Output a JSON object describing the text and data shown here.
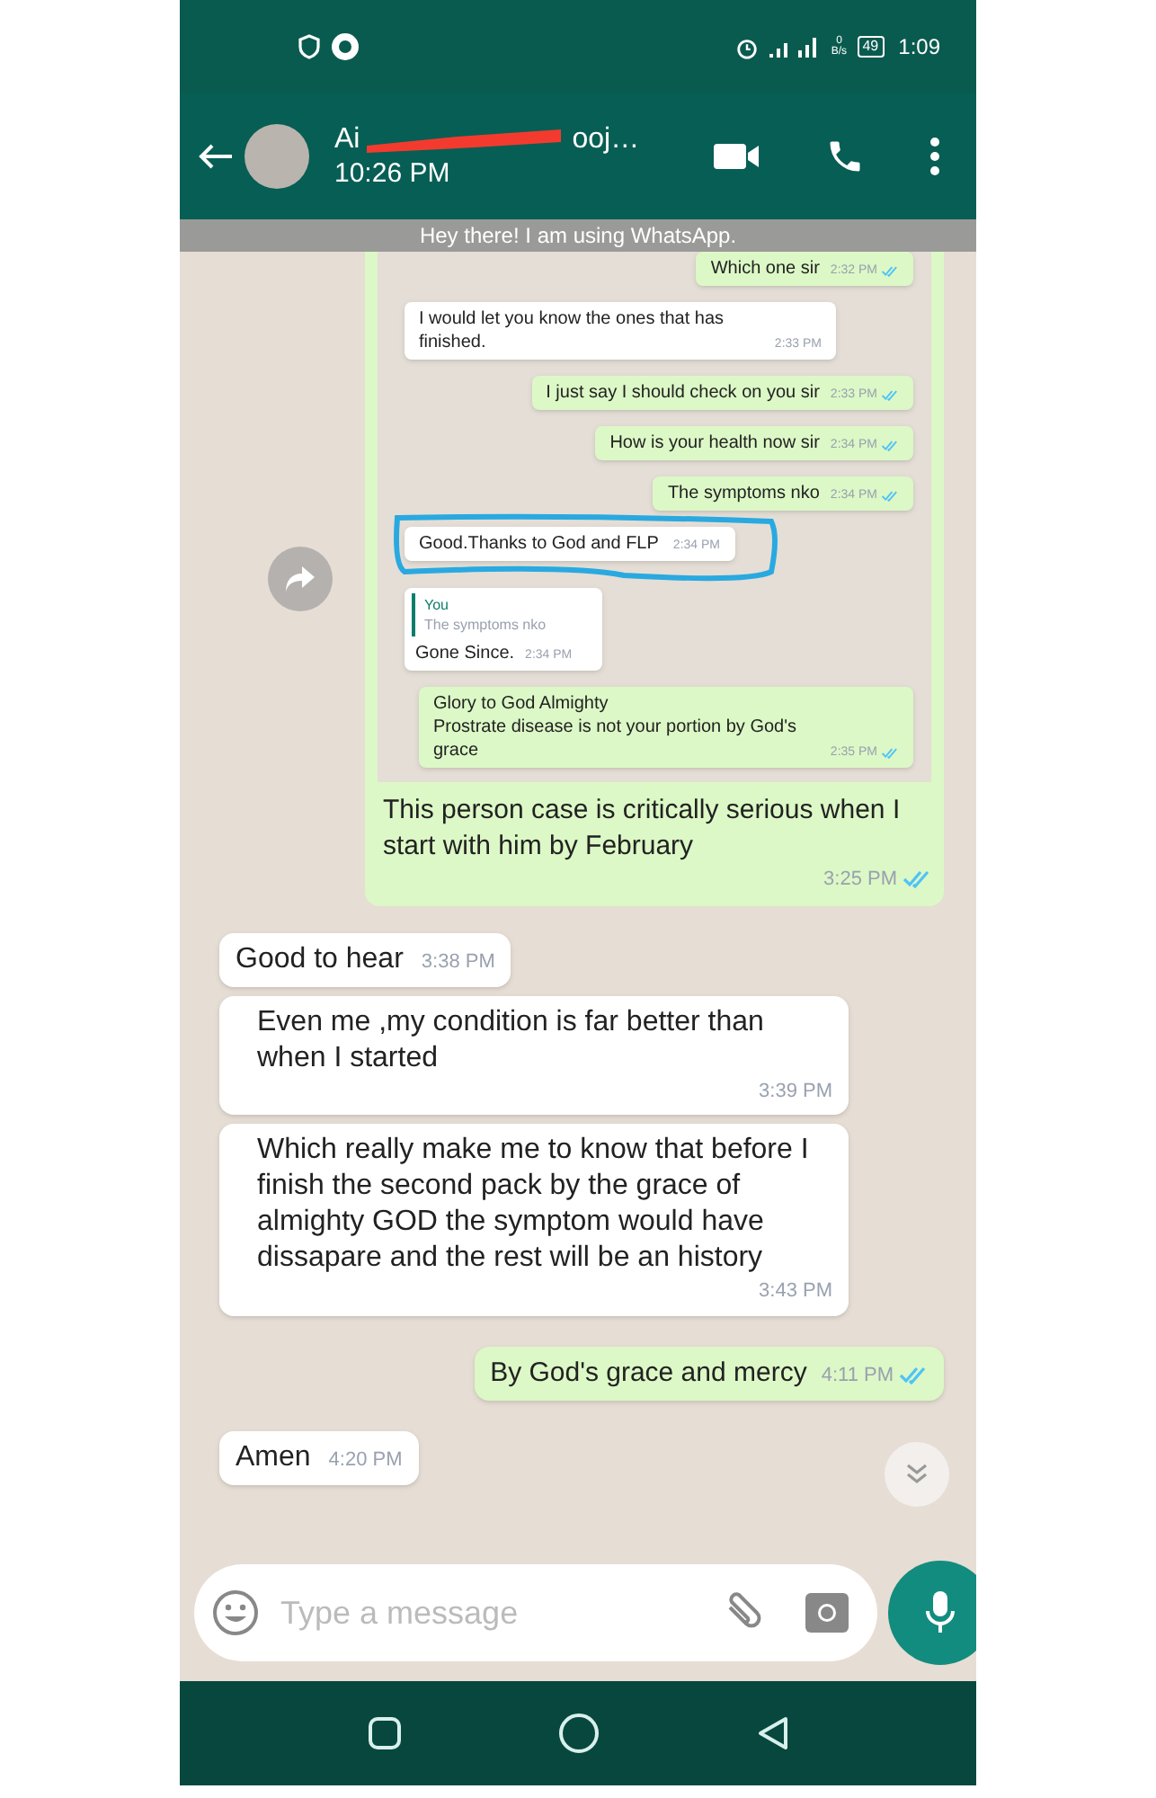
{
  "status_bar": {
    "network_speed": "0 B/s",
    "battery": "49",
    "time": "1:09"
  },
  "header": {
    "name_start": "Ai",
    "name_end": "ooj…",
    "last_seen": "10:26 PM",
    "about": "Hey there! I am using WhatsApp."
  },
  "messages": [
    {
      "kind": "screenshot",
      "text": "This person case is critically serious when I start with him by February",
      "time": "3:25 PM",
      "read": true,
      "forwardable": true,
      "shot": [
        {
          "kind": "out",
          "text": "Which one sir",
          "time": "2:32 PM",
          "read": true
        },
        {
          "kind": "in",
          "text": "I would let you know the ones that has finished.",
          "time": "2:33 PM"
        },
        {
          "kind": "out",
          "text": "I just say I should check on you sir",
          "time": "2:33 PM",
          "read": true
        },
        {
          "kind": "out",
          "text": "How is your health now sir",
          "time": "2:34 PM",
          "read": true
        },
        {
          "kind": "out",
          "text": "The symptoms nko",
          "time": "2:34 PM",
          "read": true
        },
        {
          "kind": "in",
          "text": "Good.Thanks to God and FLP",
          "time": "2:34 PM",
          "highlighted": true
        },
        {
          "kind": "reply",
          "quote_author": "You",
          "quote_text": "The symptoms nko",
          "text": "Gone Since.",
          "time": "2:34 PM"
        },
        {
          "kind": "out",
          "text": "Glory to God Almighty\nProstrate disease is not your portion by God's grace",
          "time": "2:35 PM",
          "read": true
        }
      ]
    },
    {
      "kind": "in",
      "text": "Good  to hear",
      "time": "3:38 PM"
    },
    {
      "kind": "in",
      "text": "Even me ,my condition  is far better than when I started",
      "time": "3:39 PM"
    },
    {
      "kind": "in",
      "text": "Which really make me to know that before I finish the second pack by the grace of almighty GOD the symptom would have dissapare and the rest will be an history",
      "time": "3:43 PM"
    },
    {
      "kind": "out",
      "text": "By God's grace and mercy",
      "time": "4:11 PM",
      "read": true
    },
    {
      "kind": "in",
      "text": "Amen",
      "time": "4:20 PM"
    }
  ],
  "composer": {
    "placeholder": "Type a message"
  }
}
